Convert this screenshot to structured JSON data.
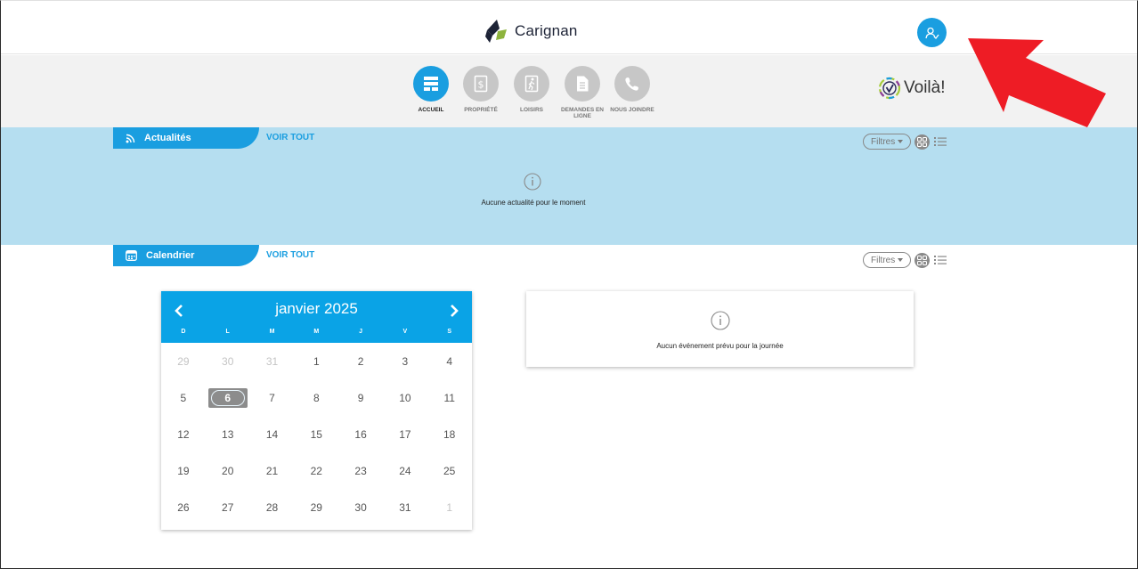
{
  "header": {
    "brand_name": "Carignan",
    "user_icon": "user-account-icon"
  },
  "nav": {
    "items": [
      {
        "label": "ACCUEIL",
        "icon": "home-dashboard-icon",
        "active": true
      },
      {
        "label": "PROPRIÉTÉ",
        "icon": "dollar-tag-icon",
        "active": false
      },
      {
        "label": "LOISIRS",
        "icon": "walker-icon",
        "active": false
      },
      {
        "label": "DEMANDES EN LIGNE",
        "icon": "document-icon",
        "active": false
      },
      {
        "label": "NOUS JOINDRE",
        "icon": "phone-icon",
        "active": false
      }
    ],
    "partner_logo_text": "Voilà!"
  },
  "news": {
    "title": "Actualités",
    "see_all": "VOIR TOUT",
    "filters_label": "Filtres",
    "empty_message": "Aucune actualité pour le moment"
  },
  "calendar_section": {
    "title": "Calendrier",
    "see_all": "VOIR TOUT",
    "filters_label": "Filtres",
    "month_label": "janvier 2025",
    "weekdays": [
      "D",
      "L",
      "M",
      "M",
      "J",
      "V",
      "S"
    ],
    "weeks": [
      [
        {
          "d": "29",
          "m": true
        },
        {
          "d": "30",
          "m": true
        },
        {
          "d": "31",
          "m": true
        },
        {
          "d": "1"
        },
        {
          "d": "2"
        },
        {
          "d": "3"
        },
        {
          "d": "4"
        }
      ],
      [
        {
          "d": "5"
        },
        {
          "d": "6",
          "t": true
        },
        {
          "d": "7"
        },
        {
          "d": "8"
        },
        {
          "d": "9"
        },
        {
          "d": "10"
        },
        {
          "d": "11"
        }
      ],
      [
        {
          "d": "12"
        },
        {
          "d": "13"
        },
        {
          "d": "14"
        },
        {
          "d": "15"
        },
        {
          "d": "16"
        },
        {
          "d": "17"
        },
        {
          "d": "18"
        }
      ],
      [
        {
          "d": "19"
        },
        {
          "d": "20"
        },
        {
          "d": "21"
        },
        {
          "d": "22"
        },
        {
          "d": "23"
        },
        {
          "d": "24"
        },
        {
          "d": "25"
        }
      ],
      [
        {
          "d": "26"
        },
        {
          "d": "27"
        },
        {
          "d": "28"
        },
        {
          "d": "29"
        },
        {
          "d": "30"
        },
        {
          "d": "31"
        },
        {
          "d": "1",
          "m": true
        }
      ]
    ],
    "events_empty_message": "Aucun événement prévu pour la journée"
  },
  "colors": {
    "accent": "#1a9ee0",
    "news_band": "#b5def0",
    "annotation_arrow": "#ee1c25"
  }
}
